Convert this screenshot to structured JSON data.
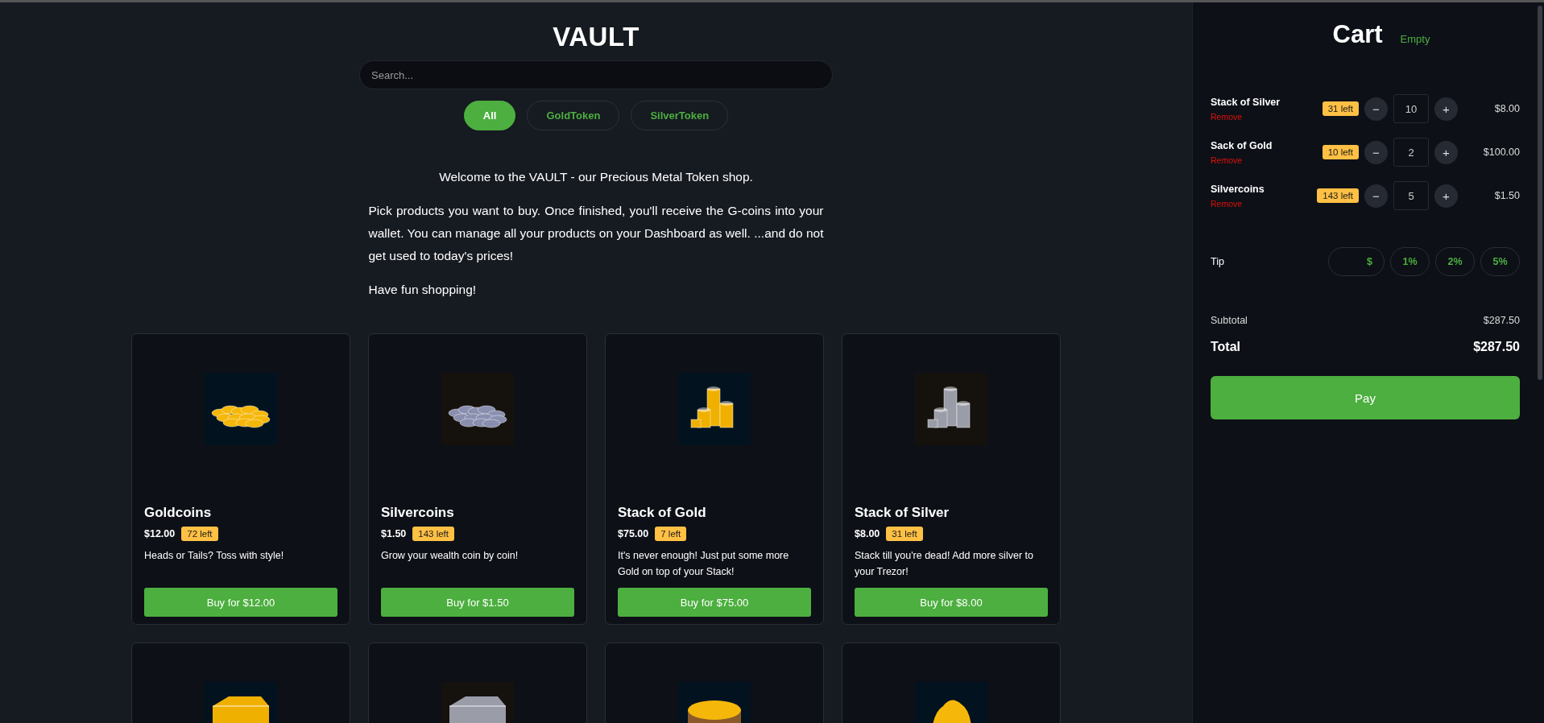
{
  "shop": {
    "title": "VAULT",
    "search": {
      "placeholder": "Search..."
    },
    "filters": [
      {
        "label": "All",
        "selected": true
      },
      {
        "label": "GoldToken",
        "selected": false
      },
      {
        "label": "SilverToken",
        "selected": false
      }
    ],
    "intro": [
      "Welcome to the VAULT - our Precious Metal Token shop.",
      "Pick products you want to buy. Once finished, you'll receive the G-coins into your wallet. You can manage all your products on your Dashboard as well. ...and do not get used to today's prices!",
      "Have fun shopping!"
    ],
    "products": [
      {
        "image": {
          "kind": "pile",
          "color": "#f5b70a"
        },
        "name": "Goldcoins",
        "price": "$12.00",
        "stock": "72 left",
        "description": "Heads or Tails? Toss with style!",
        "button": "Buy for $12.00"
      },
      {
        "image": {
          "kind": "pile",
          "color": "#8a8fb0"
        },
        "name": "Silvercoins",
        "price": "$1.50",
        "stock": "143 left",
        "description": "Grow your wealth coin by coin!",
        "button": "Buy for $1.50"
      },
      {
        "image": {
          "kind": "stack",
          "color": "#f0b000"
        },
        "name": "Stack of Gold",
        "price": "$75.00",
        "stock": "7 left",
        "description": "It's never enough! Just put some more Gold on top of your Stack!",
        "button": "Buy for $75.00"
      },
      {
        "image": {
          "kind": "stack",
          "color": "#9a9ca8"
        },
        "name": "Stack of Silver",
        "price": "$8.00",
        "stock": "31 left",
        "description": "Stack till you're dead! Add more silver to your Trezor!",
        "button": "Buy for $8.00"
      },
      {
        "image": {
          "kind": "bar",
          "color": "#f0b000"
        }
      },
      {
        "image": {
          "kind": "bar",
          "color": "#9a9ca8"
        }
      },
      {
        "image": {
          "kind": "sack",
          "color": "#f5b70a"
        }
      },
      {
        "image": {
          "kind": "nugget",
          "color": "#f5b70a"
        }
      }
    ]
  },
  "cart": {
    "title": "Cart",
    "status": "Empty",
    "items": [
      {
        "name": "Stack of Silver",
        "remove": "Remove",
        "stock": "31 left",
        "minus": "−",
        "quantity": "10",
        "plus": "+",
        "price": "$8.00"
      },
      {
        "name": "Sack of Gold",
        "remove": "Remove",
        "stock": "10 left",
        "minus": "−",
        "quantity": "2",
        "plus": "+",
        "price": "$100.00"
      },
      {
        "name": "Silvercoins",
        "remove": "Remove",
        "stock": "143 left",
        "minus": "−",
        "quantity": "5",
        "plus": "+",
        "price": "$1.50"
      }
    ],
    "tip": {
      "label": "Tip",
      "custom_suffix": "$",
      "options": [
        {
          "label": "1%",
          "selected": false
        },
        {
          "label": "2%",
          "selected": false
        },
        {
          "label": "5%",
          "selected": false
        }
      ]
    },
    "subtotal": {
      "label": "Subtotal",
      "value": "$287.50"
    },
    "total": {
      "label": "Total",
      "value": "$287.50"
    },
    "pay_button": "Pay"
  }
}
